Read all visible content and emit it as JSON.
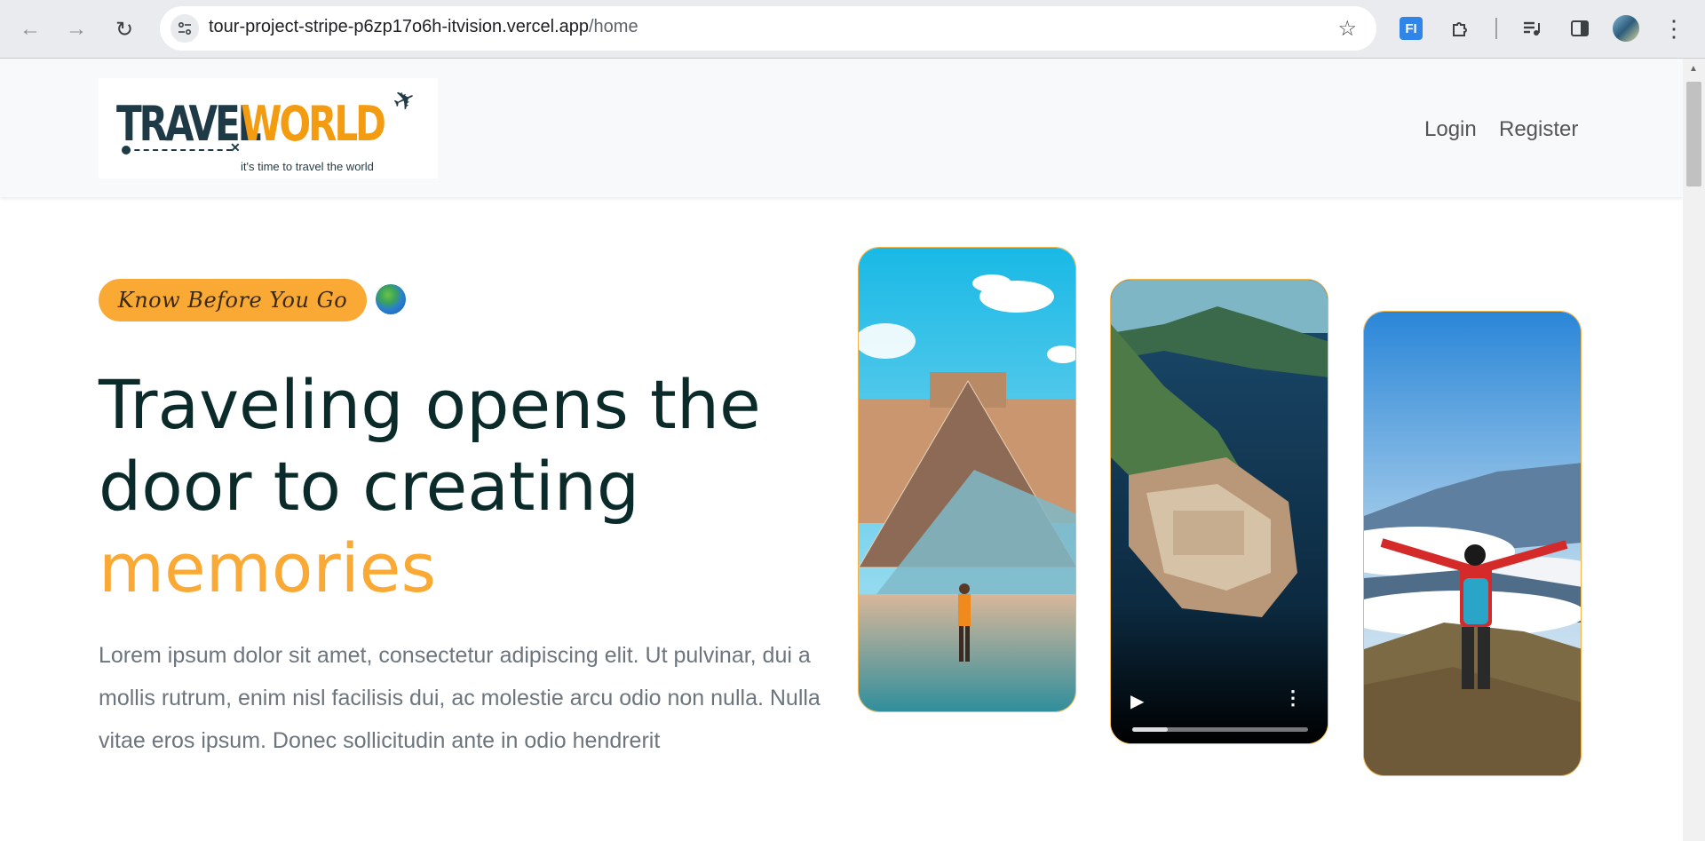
{
  "browser": {
    "url_host": "tour-project-stripe-p6zp17o6h-itvision.vercel.app",
    "url_path": "/home",
    "ext_fi_label": "FI"
  },
  "header": {
    "logo_travel": "TRAVEL",
    "logo_world": "WORLD",
    "logo_tagline": "it's time to travel the world",
    "nav_login": "Login",
    "nav_register": "Register"
  },
  "hero": {
    "pill_label": "Know Before You Go",
    "title_line1": "Traveling opens the",
    "title_line2": "door to creating",
    "title_highlight": "memories",
    "body": "Lorem ipsum dolor sit amet, consectetur adipiscing elit. Ut pulvinar, dui a mollis rutrum, enim nisl facilisis dui, ac molestie arcu odio non nulla. Nulla vitae eros ipsum. Donec sollicitudin ante in odio hendrerit"
  },
  "video": {
    "progress": 0.2
  },
  "colors": {
    "accent": "#faa935",
    "heading": "#0b2a2a",
    "body_text": "#6c757d",
    "card_border": "#f3b44a"
  },
  "icons": {
    "back": "arrow-left-icon",
    "forward": "arrow-right-icon",
    "reload": "reload-icon",
    "bookmark": "star-icon",
    "extensions": "puzzle-icon",
    "media": "media-control-icon",
    "side_panel": "side-panel-icon",
    "menu": "kebab-menu-icon",
    "globe": "globe-icon",
    "play": "play-icon"
  }
}
